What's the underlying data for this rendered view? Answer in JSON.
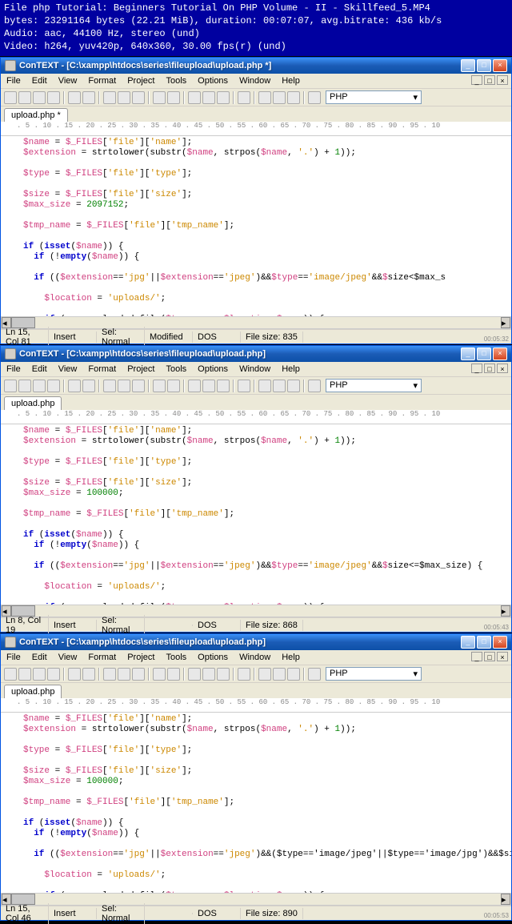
{
  "terminal": {
    "l1": "File php Tutorial: Beginners Tutorial On PHP Volume - II - Skillfeed_5.MP4",
    "l2": "bytes: 23291164 bytes (22.21 MiB), duration: 00:07:07, avg.bitrate: 436 kb/s",
    "l3": "Audio: aac, 44100 Hz, stereo (und)",
    "l4": "Video: h264, yuv420p, 640x360, 30.00 fps(r) (und)"
  },
  "win1": {
    "title": "ConTEXT - [C:\\xampp\\htdocs\\series\\fileupload\\upload.php *]",
    "tab": "upload.php *",
    "lang": "PHP",
    "status": {
      "pos": "Ln 15, Col 81",
      "ins": "Insert",
      "sel": "Sel: Normal",
      "mod": "Modified",
      "enc": "DOS",
      "size": "File size: 835"
    },
    "max_size": "2097152",
    "cond_tail": "size<$max_s",
    "time": "00:05:32"
  },
  "win2": {
    "title": "ConTEXT - [C:\\xampp\\htdocs\\series\\fileupload\\upload.php]",
    "tab": "upload.php",
    "lang": "PHP",
    "status": {
      "pos": "Ln 8, Col 19",
      "ins": "Insert",
      "sel": "Sel: Normal",
      "mod": "",
      "enc": "DOS",
      "size": "File size: 868"
    },
    "max_size": "100000",
    "cond_tail": "size<=$max_size) {",
    "time": "00:05:43"
  },
  "win3": {
    "title": "ConTEXT - [C:\\xampp\\htdocs\\series\\fileupload\\upload.php]",
    "tab": "upload.php",
    "lang": "PHP",
    "status": {
      "pos": "Ln 15, Col 46",
      "ins": "Insert",
      "sel": "Sel: Normal",
      "mod": "",
      "enc": "DOS",
      "size": "File size: 890"
    },
    "max_size": "100000",
    "cond_tail": "($type=='image/jpeg'||$type=='image/jpg')&&$size<=$",
    "time": "00:05:53"
  },
  "menu": {
    "file": "File",
    "edit": "Edit",
    "view": "View",
    "format": "Format",
    "project": "Project",
    "tools": "Tools",
    "options": "Options",
    "window": "Window",
    "help": "Help"
  },
  "ruler_marks": "    . 5 . 10 . 15 . 20 . 25 . 30 . 35 . 40 . 45 . 50 . 55 . 60 . 65 . 70 . 75 . 80 . 85 . 90 . 95 . 10"
}
